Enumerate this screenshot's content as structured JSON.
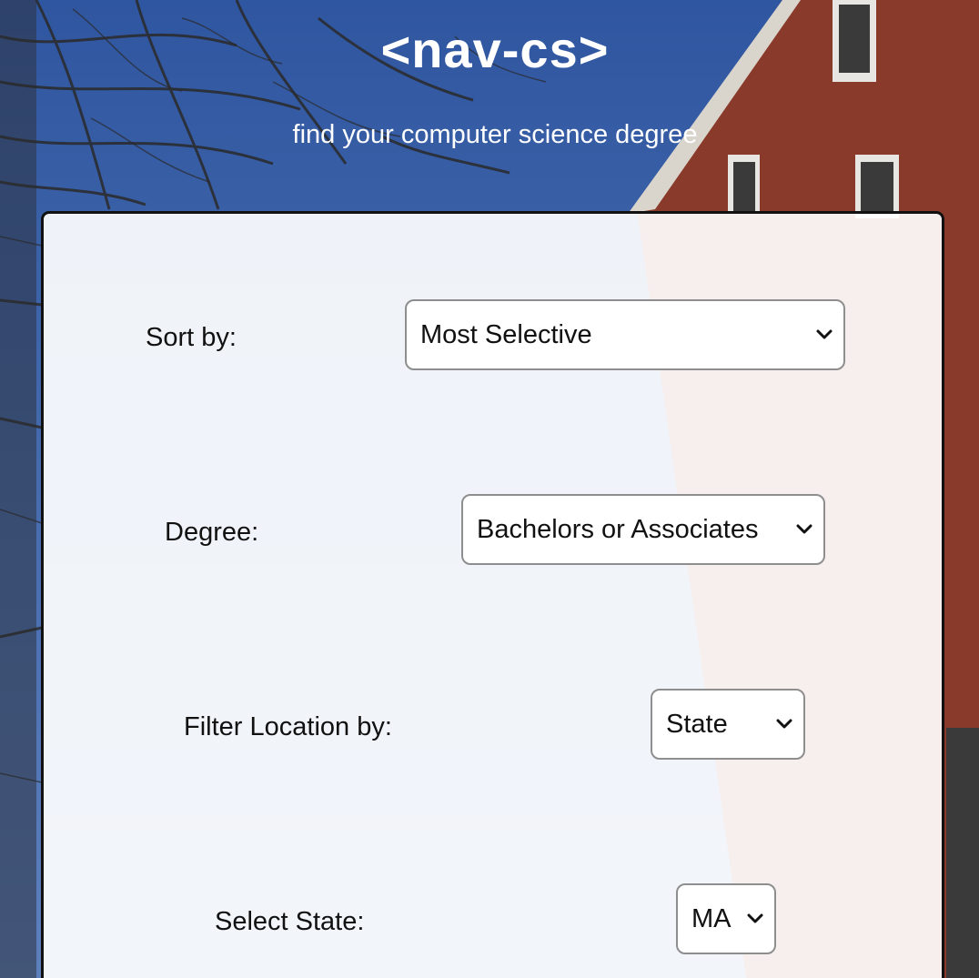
{
  "header": {
    "title": "<nav-cs>",
    "tagline": "find your computer science degree"
  },
  "filters": {
    "sort": {
      "label": "Sort by:",
      "selected": "Most Selective"
    },
    "degree": {
      "label": "Degree:",
      "selected": "Bachelors or Associates"
    },
    "location": {
      "label": "Filter Location by:",
      "selected": "State"
    },
    "state": {
      "label": "Select State:",
      "selected": "MA"
    }
  },
  "colors": {
    "sky": "#3f64a8",
    "brick": "#8a3a2a",
    "panel_border": "#111111",
    "select_border": "#8e8e8e"
  }
}
